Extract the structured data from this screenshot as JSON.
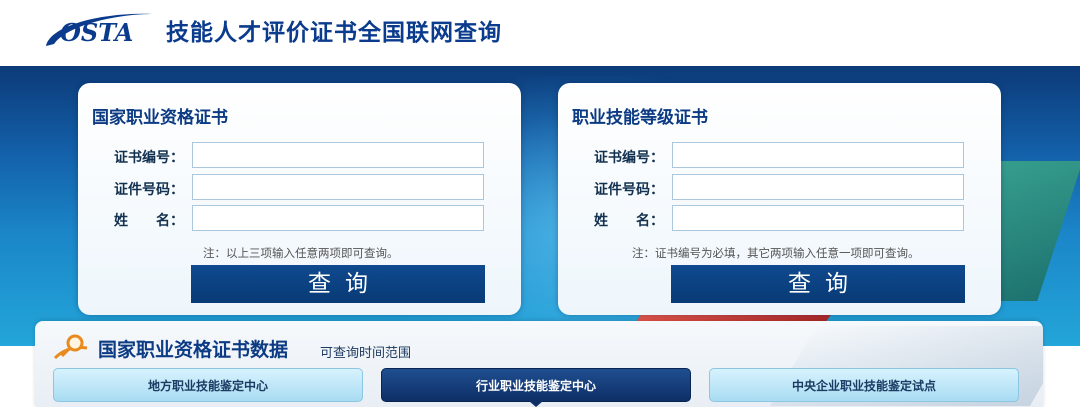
{
  "header": {
    "logo_text": "OSTA",
    "title": "技能人才评价证书全国联网查询"
  },
  "cards": [
    {
      "title": "国家职业资格证书",
      "fields": [
        {
          "label": "证书编号：",
          "value": ""
        },
        {
          "label": "证件号码：",
          "value": ""
        },
        {
          "label": "姓　　名：",
          "value": ""
        }
      ],
      "note": "注：以上三项输入任意两项即可查询。",
      "button": "查询"
    },
    {
      "title": "职业技能等级证书",
      "fields": [
        {
          "label": "证书编号：",
          "value": ""
        },
        {
          "label": "证件号码：",
          "value": ""
        },
        {
          "label": "姓　　名：",
          "value": ""
        }
      ],
      "note": "注：证书编号为必填，其它两项输入任意一项即可查询。",
      "button": "查询"
    }
  ],
  "data_panel": {
    "title": "国家职业资格证书数据",
    "subtitle": "可查询时间范围",
    "icon": "magnifier-icon",
    "tabs": [
      {
        "label": "地方职业技能鉴定中心",
        "active": false
      },
      {
        "label": "行业职业技能鉴定中心",
        "active": true
      },
      {
        "label": "中央企业职业技能鉴定试点",
        "active": false
      }
    ]
  },
  "colors": {
    "brand_blue": "#0c3b84",
    "button_blue": "#0f4a8f",
    "tab_active": "#0e2f66",
    "tab_inactive": "#a9dcf2"
  }
}
